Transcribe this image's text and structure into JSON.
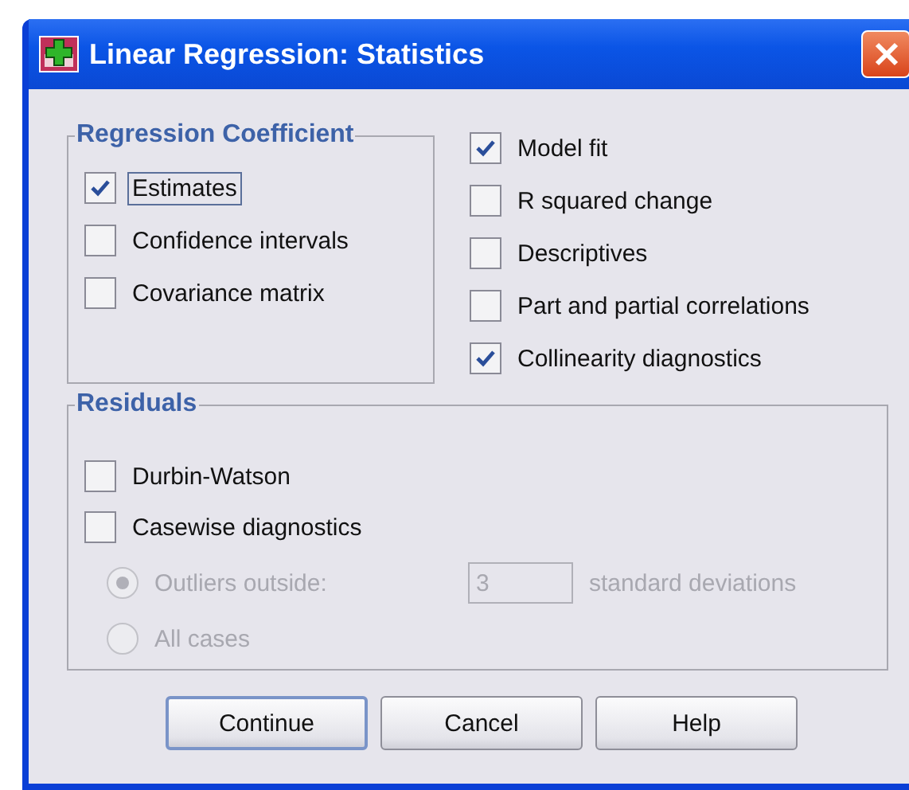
{
  "window": {
    "title": "Linear Regression: Statistics"
  },
  "regression_coefficient": {
    "title": "Regression Coefficient",
    "options": [
      {
        "label": "Estimates",
        "checked": true,
        "focused": true
      },
      {
        "label": "Confidence intervals",
        "checked": false,
        "focused": false
      },
      {
        "label": "Covariance matrix",
        "checked": false,
        "focused": false
      }
    ]
  },
  "other_options": [
    {
      "label": "Model fit",
      "checked": true
    },
    {
      "label": "R squared change",
      "checked": false
    },
    {
      "label": "Descriptives",
      "checked": false
    },
    {
      "label": "Part and partial correlations",
      "checked": false
    },
    {
      "label": "Collinearity diagnostics",
      "checked": true
    }
  ],
  "residuals": {
    "title": "Residuals",
    "options": [
      {
        "label": "Durbin-Watson",
        "checked": false
      },
      {
        "label": "Casewise diagnostics",
        "checked": false
      }
    ],
    "casewise": {
      "disabled": true,
      "choices": [
        {
          "label": "Outliers outside:",
          "selected": true
        },
        {
          "label": "All cases",
          "selected": false
        }
      ],
      "value": "3",
      "unit": "standard deviations"
    }
  },
  "buttons": [
    {
      "label": "Continue",
      "default": true
    },
    {
      "label": "Cancel",
      "default": false
    },
    {
      "label": "Help",
      "default": false
    }
  ]
}
